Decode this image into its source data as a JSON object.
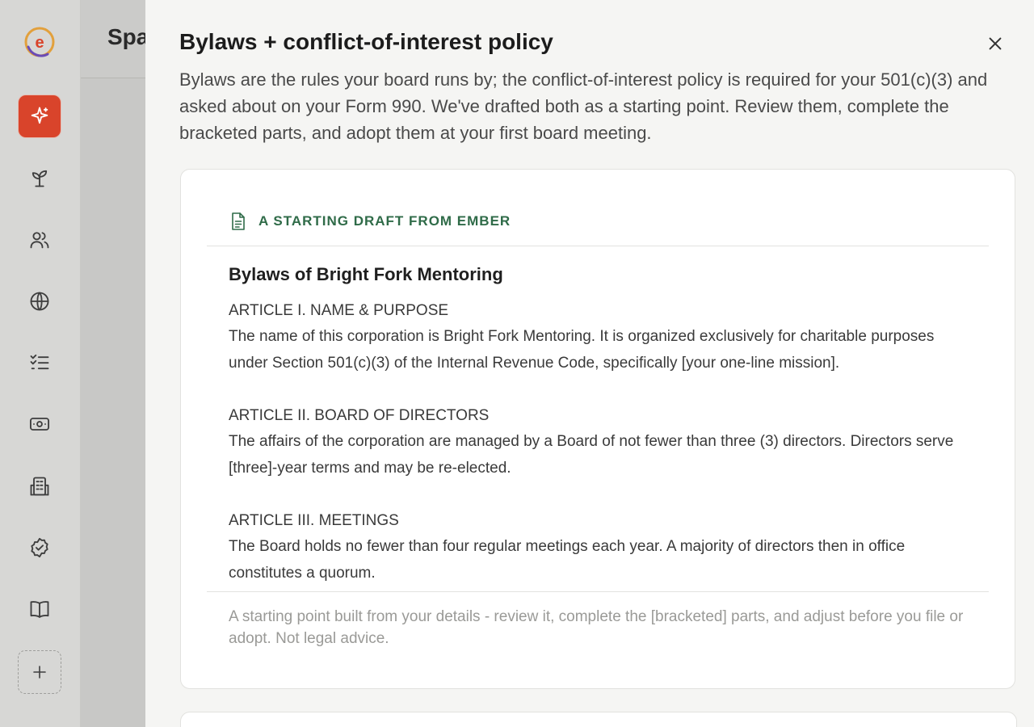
{
  "rail": {
    "logo_letter": "e",
    "items": [
      {
        "icon": "sparkle-icon",
        "active": true
      },
      {
        "icon": "seedling-icon"
      },
      {
        "icon": "people-icon"
      },
      {
        "icon": "globe-icon"
      },
      {
        "icon": "checklist-icon"
      },
      {
        "icon": "money-icon"
      },
      {
        "icon": "building-icon"
      },
      {
        "icon": "badge-check-icon"
      },
      {
        "icon": "book-icon"
      },
      {
        "icon": "plus-icon"
      }
    ],
    "colors": {
      "active": "#d9442b",
      "rail_bg": "#d7d7d5"
    }
  },
  "behind": {
    "title_fragment": "Spa"
  },
  "panel": {
    "title": "Bylaws + conflict-of-interest policy",
    "description": "Bylaws are the rules your board runs by; the conflict-of-interest policy is required for your 501(c)(3) and asked about on your Form 990. We've drafted both as a starting point. Review them, complete the bracketed parts, and adopt them at your first board meeting.",
    "card": {
      "label": "A STARTING DRAFT FROM EMBER",
      "label_color": "#2f6b48",
      "doc_title": "Bylaws of Bright Fork Mentoring",
      "articles": [
        {
          "heading": "ARTICLE I. NAME & PURPOSE",
          "body": "The name of this corporation is Bright Fork Mentoring. It is organized exclusively for charitable purposes under Section 501(c)(3) of the Internal Revenue Code, specifically [your one-line mission]."
        },
        {
          "heading": "ARTICLE II. BOARD OF DIRECTORS",
          "body": "The affairs of the corporation are managed by a Board of not fewer than three (3) directors. Directors serve [three]-year terms and may be re-elected."
        },
        {
          "heading": "ARTICLE III. MEETINGS",
          "body": "The Board holds no fewer than four regular meetings each year. A majority of directors then in office constitutes a quorum."
        }
      ],
      "footnote": "A starting point built from your details - review it, complete the [bracketed] parts, and adjust before you file or adopt. Not legal advice."
    }
  }
}
